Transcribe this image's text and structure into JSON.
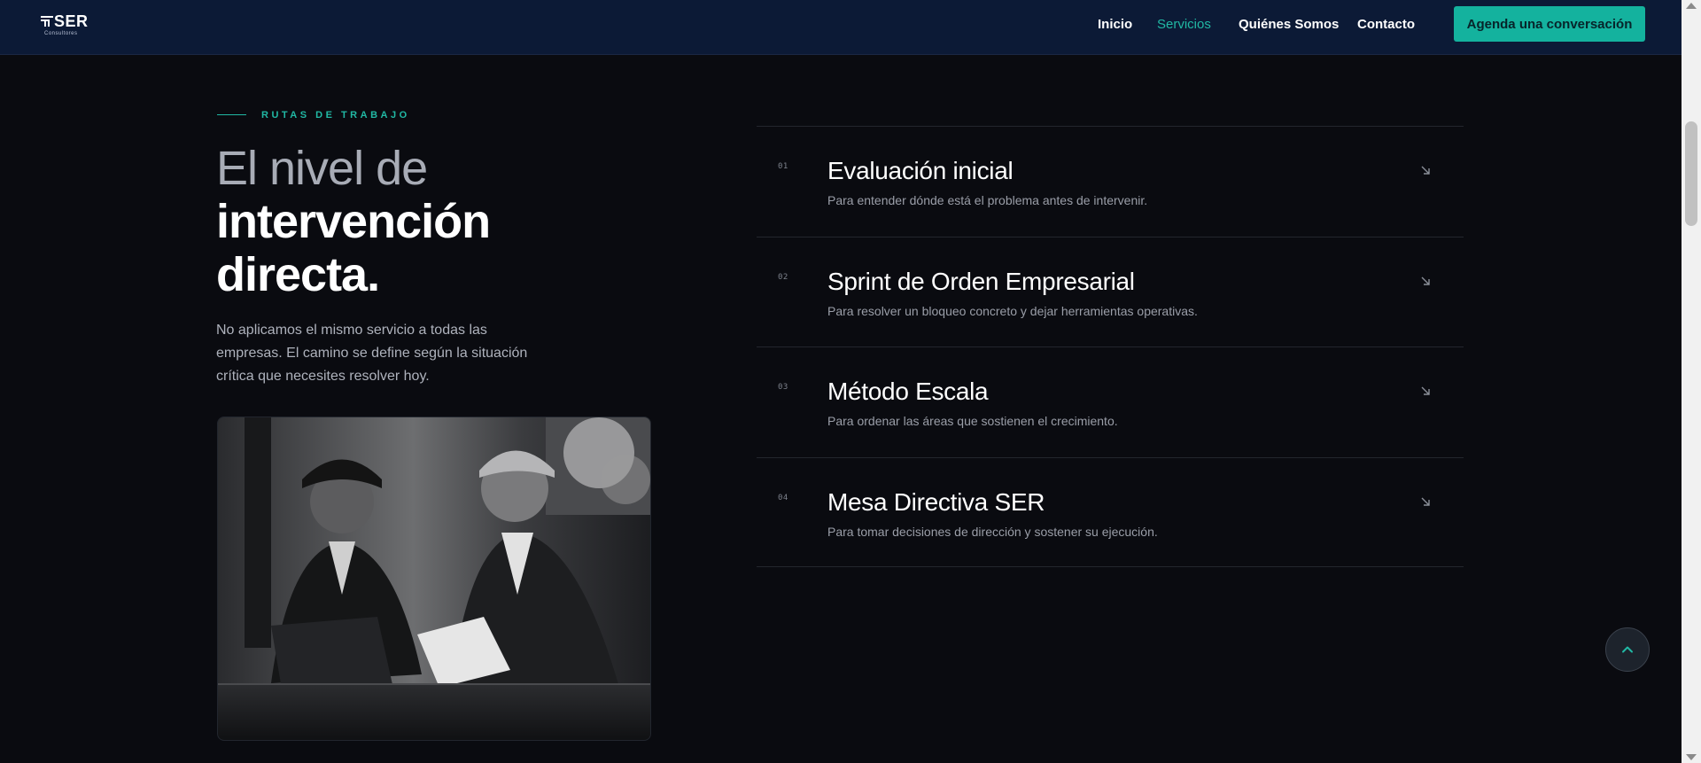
{
  "header": {
    "logo_text": "SER",
    "logo_sub": "Consultores",
    "nav": [
      {
        "label": "Inicio",
        "active": false
      },
      {
        "label": "Servicios",
        "active": true
      },
      {
        "label": "Quiénes Somos",
        "active": false
      },
      {
        "label": "Contacto",
        "active": false
      }
    ],
    "cta_label": "Agenda una conversación"
  },
  "section": {
    "eyebrow": "RUTAS DE TRABAJO",
    "headline_light": "El nivel de",
    "headline_bold_1": "intervención",
    "headline_bold_2": "directa.",
    "intro": "No aplicamos el mismo servicio a todas las empresas. El camino se define según la situación crítica que necesites resolver hoy."
  },
  "routes": [
    {
      "num": "01",
      "title": "Evaluación inicial",
      "desc": "Para entender dónde está el problema antes de intervenir."
    },
    {
      "num": "02",
      "title": "Sprint de Orden Empresarial",
      "desc": "Para resolver un bloqueo concreto y dejar herramientas operativas."
    },
    {
      "num": "03",
      "title": "Método Escala",
      "desc": "Para ordenar las áreas que sostienen el crecimiento."
    },
    {
      "num": "04",
      "title": "Mesa Directiva SER",
      "desc": "Para tomar decisiones de dirección y sostener su ejecución."
    }
  ],
  "colors": {
    "accent": "#21b8a4",
    "header_bg": "#0c1a36",
    "page_bg": "#0a0b10"
  },
  "icons": {
    "route_arrow": "arrow-down-right-icon",
    "to_top": "chevron-up-icon"
  }
}
